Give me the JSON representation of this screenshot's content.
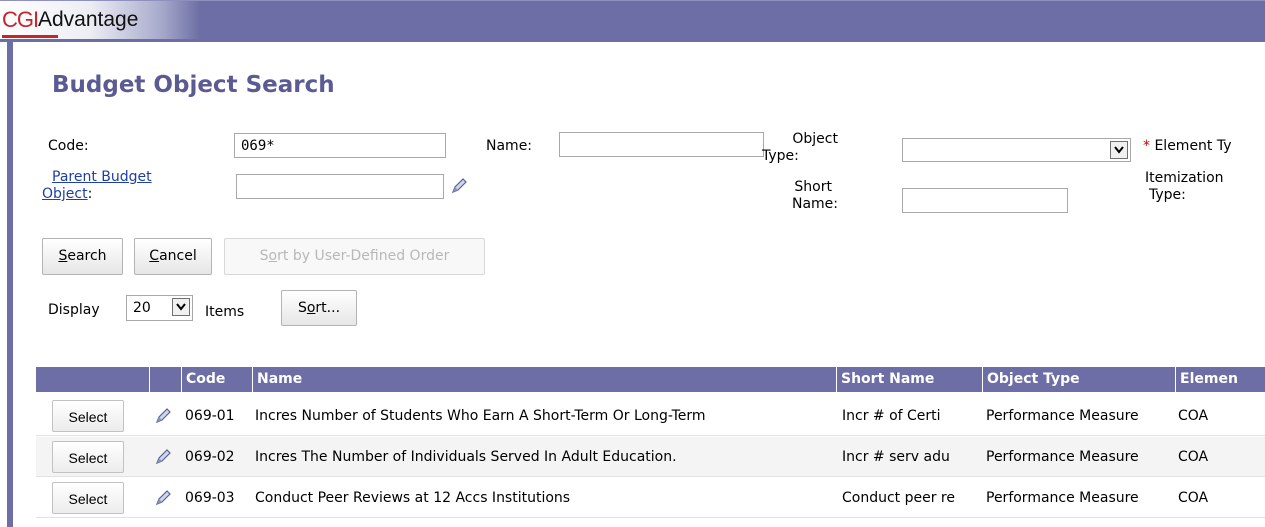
{
  "app": {
    "logo_cgi": "CGI",
    "logo_name": "Advantage"
  },
  "page": {
    "title": "Budget Object Search"
  },
  "form": {
    "code_label": "Code:",
    "code_value": "069*",
    "name_label": "Name:",
    "name_value": "",
    "object_type_label_1": "Object",
    "object_type_label_2": "Type:",
    "object_type_value": "",
    "element_type_required": "*",
    "element_type_label": "Element Ty",
    "parent_label_1": "Parent Budget",
    "parent_label_2": "Object",
    "parent_colon": ":",
    "parent_value": "",
    "short_name_label_1": "Short",
    "short_name_label_2": "Name:",
    "short_name_value": "",
    "itemization_label_1": "Itemization",
    "itemization_label_2": "Type:"
  },
  "buttons": {
    "search_hot": "S",
    "search_rest": "earch",
    "cancel_hot": "C",
    "cancel_rest": "ancel",
    "sort_udo_pre": "S",
    "sort_udo_hot": "o",
    "sort_udo_rest": "rt by User-Defined Order"
  },
  "display": {
    "label": "Display",
    "value": "20",
    "items_label": "Items",
    "sort_pre": "S",
    "sort_hot": "o",
    "sort_rest": "rt..."
  },
  "grid": {
    "headers": {
      "code": "Code",
      "name": "Name",
      "short_name": "Short Name",
      "object_type": "Object Type",
      "element": "Elemen"
    },
    "select_label": "Select",
    "rows": [
      {
        "code": "069-01",
        "name": "Incres Number of Students Who Earn A Short-Term Or Long-Term",
        "short_name": "Incr # of Certi",
        "object_type": "Performance Measure",
        "element": "COA"
      },
      {
        "code": "069-02",
        "name": "Incres The Number of Individuals Served In Adult Education.",
        "short_name": "Incr # serv adu",
        "object_type": "Performance Measure",
        "element": "COA"
      },
      {
        "code": "069-03",
        "name": "Conduct Peer Reviews at 12 Accs Institutions",
        "short_name": "Conduct peer re",
        "object_type": "Performance Measure",
        "element": "COA"
      }
    ]
  },
  "icons": {
    "edit": "pencil-icon",
    "dropdown": "chevron-down-icon"
  },
  "colors": {
    "header": "#6d6ea5",
    "title": "#5c5a92",
    "link": "#1d3fa6",
    "required": "#cc0000",
    "logo_red": "#c8242c"
  }
}
